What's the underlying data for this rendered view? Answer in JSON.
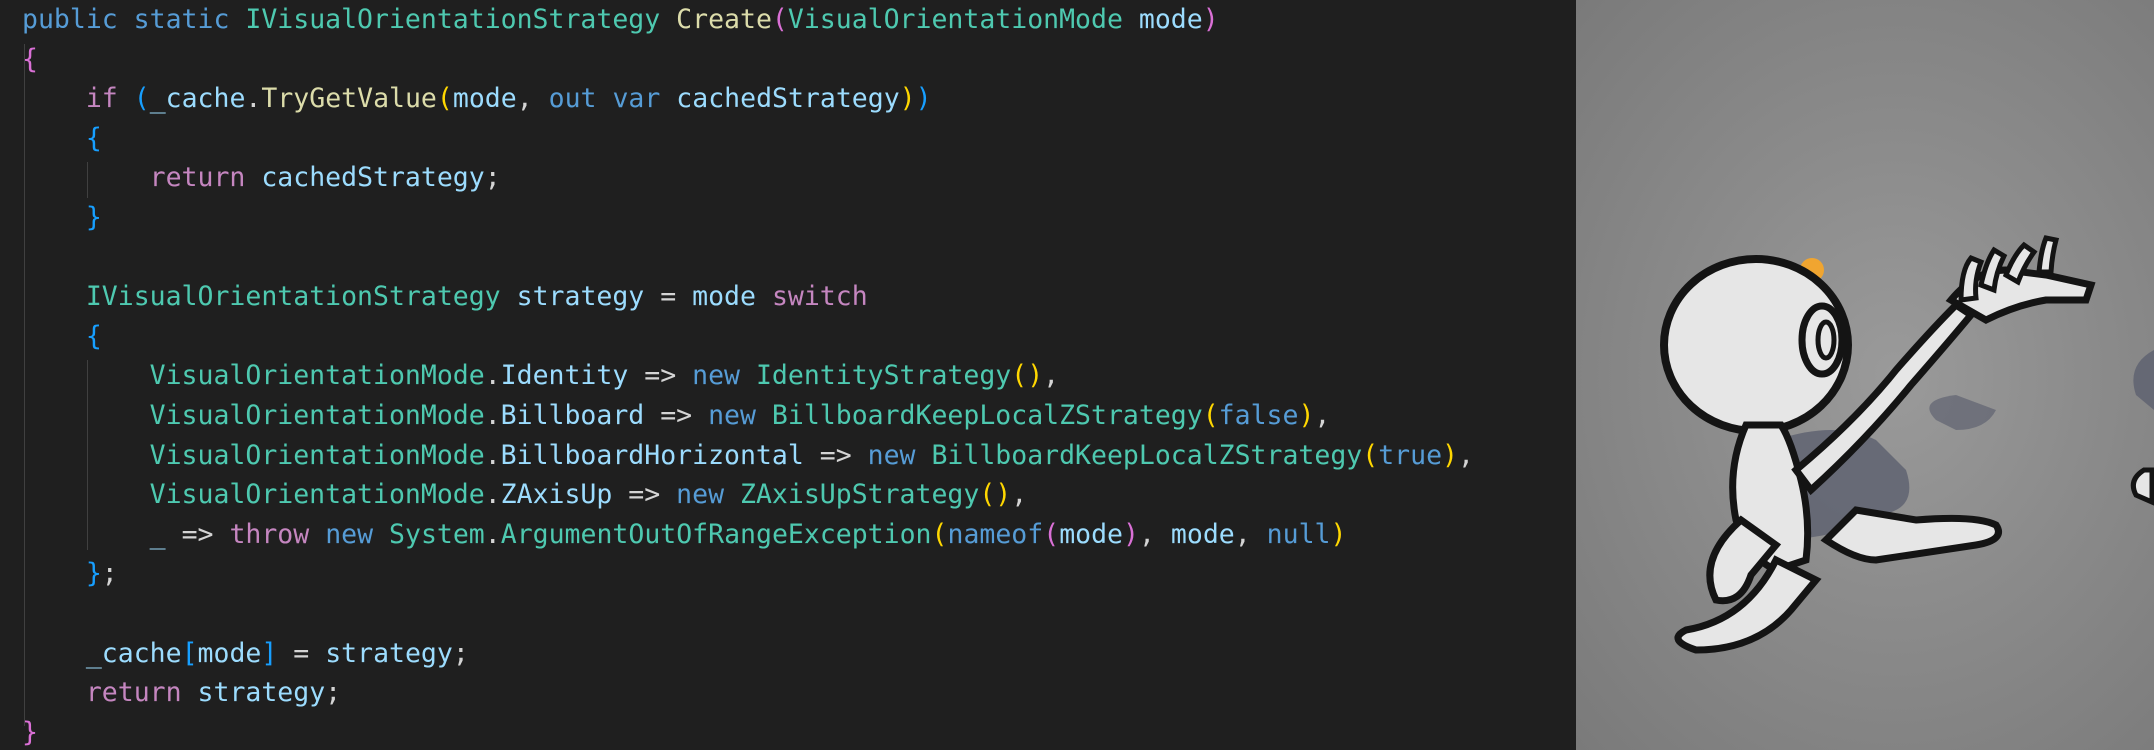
{
  "editor": {
    "theme": {
      "background": "#1f1f1f",
      "default": "#d4d4d4",
      "keyword": "#569cd6",
      "control": "#c586c0",
      "type": "#4ec9b0",
      "method": "#dcdcaa",
      "variable": "#9cdcfe",
      "bracket1": "#ffd700",
      "bracket2": "#da70d6",
      "bracket3": "#179fff"
    },
    "lines": [
      [
        [
          "public static ",
          "keyword"
        ],
        [
          "IVisualOrientationStrategy",
          "type"
        ],
        [
          " ",
          "default"
        ],
        [
          "Create",
          "method"
        ],
        [
          "(",
          "bracket2"
        ],
        [
          "VisualOrientationMode",
          "type"
        ],
        [
          " ",
          "default"
        ],
        [
          "mode",
          "variable"
        ],
        [
          ")",
          "bracket2"
        ]
      ],
      [
        [
          "{",
          "bracket2"
        ]
      ],
      [
        [
          "    ",
          "default"
        ],
        [
          "if",
          "control"
        ],
        [
          " ",
          "default"
        ],
        [
          "(",
          "bracket3"
        ],
        [
          "_cache",
          "variable"
        ],
        [
          ".",
          "default"
        ],
        [
          "TryGetValue",
          "method"
        ],
        [
          "(",
          "bracket1"
        ],
        [
          "mode",
          "variable"
        ],
        [
          ", ",
          "default"
        ],
        [
          "out",
          "keyword"
        ],
        [
          " ",
          "default"
        ],
        [
          "var",
          "keyword"
        ],
        [
          " ",
          "default"
        ],
        [
          "cachedStrategy",
          "variable"
        ],
        [
          ")",
          "bracket1"
        ],
        [
          ")",
          "bracket3"
        ]
      ],
      [
        [
          "    ",
          "default"
        ],
        [
          "{",
          "bracket3"
        ]
      ],
      [
        [
          "        ",
          "default"
        ],
        [
          "return",
          "control"
        ],
        [
          " ",
          "default"
        ],
        [
          "cachedStrategy",
          "variable"
        ],
        [
          ";",
          "default"
        ]
      ],
      [
        [
          "    ",
          "default"
        ],
        [
          "}",
          "bracket3"
        ]
      ],
      [],
      [
        [
          "    ",
          "default"
        ],
        [
          "IVisualOrientationStrategy",
          "type"
        ],
        [
          " ",
          "default"
        ],
        [
          "strategy",
          "variable"
        ],
        [
          " = ",
          "default"
        ],
        [
          "mode",
          "variable"
        ],
        [
          " ",
          "default"
        ],
        [
          "switch",
          "control"
        ]
      ],
      [
        [
          "    ",
          "default"
        ],
        [
          "{",
          "bracket3"
        ]
      ],
      [
        [
          "        ",
          "default"
        ],
        [
          "VisualOrientationMode",
          "type"
        ],
        [
          ".",
          "default"
        ],
        [
          "Identity",
          "variable"
        ],
        [
          " => ",
          "default"
        ],
        [
          "new",
          "keyword"
        ],
        [
          " ",
          "default"
        ],
        [
          "IdentityStrategy",
          "type"
        ],
        [
          "()",
          "bracket1"
        ],
        [
          ",",
          "default"
        ]
      ],
      [
        [
          "        ",
          "default"
        ],
        [
          "VisualOrientationMode",
          "type"
        ],
        [
          ".",
          "default"
        ],
        [
          "Billboard",
          "variable"
        ],
        [
          " => ",
          "default"
        ],
        [
          "new",
          "keyword"
        ],
        [
          " ",
          "default"
        ],
        [
          "BillboardKeepLocalZStrategy",
          "type"
        ],
        [
          "(",
          "bracket1"
        ],
        [
          "false",
          "keyword"
        ],
        [
          ")",
          "bracket1"
        ],
        [
          ",",
          "default"
        ]
      ],
      [
        [
          "        ",
          "default"
        ],
        [
          "VisualOrientationMode",
          "type"
        ],
        [
          ".",
          "default"
        ],
        [
          "BillboardHorizontal",
          "variable"
        ],
        [
          " => ",
          "default"
        ],
        [
          "new",
          "keyword"
        ],
        [
          " ",
          "default"
        ],
        [
          "BillboardKeepLocalZStrategy",
          "type"
        ],
        [
          "(",
          "bracket1"
        ],
        [
          "true",
          "keyword"
        ],
        [
          ")",
          "bracket1"
        ],
        [
          ",",
          "default"
        ]
      ],
      [
        [
          "        ",
          "default"
        ],
        [
          "VisualOrientationMode",
          "type"
        ],
        [
          ".",
          "default"
        ],
        [
          "ZAxisUp",
          "variable"
        ],
        [
          " => ",
          "default"
        ],
        [
          "new",
          "keyword"
        ],
        [
          " ",
          "default"
        ],
        [
          "ZAxisUpStrategy",
          "type"
        ],
        [
          "()",
          "bracket1"
        ],
        [
          ",",
          "default"
        ]
      ],
      [
        [
          "        ",
          "default"
        ],
        [
          "_",
          "variable"
        ],
        [
          " => ",
          "default"
        ],
        [
          "throw",
          "control"
        ],
        [
          " ",
          "default"
        ],
        [
          "new",
          "keyword"
        ],
        [
          " ",
          "default"
        ],
        [
          "System",
          "type"
        ],
        [
          ".",
          "default"
        ],
        [
          "ArgumentOutOfRangeException",
          "type"
        ],
        [
          "(",
          "bracket1"
        ],
        [
          "nameof",
          "keyword"
        ],
        [
          "(",
          "bracket2"
        ],
        [
          "mode",
          "variable"
        ],
        [
          ")",
          "bracket2"
        ],
        [
          ", ",
          "default"
        ],
        [
          "mode",
          "variable"
        ],
        [
          ", ",
          "default"
        ],
        [
          "null",
          "keyword"
        ],
        [
          ")",
          "bracket1"
        ]
      ],
      [
        [
          "    ",
          "default"
        ],
        [
          "}",
          "bracket3"
        ],
        [
          ";",
          "default"
        ]
      ],
      [],
      [
        [
          "    ",
          "default"
        ],
        [
          "_cache",
          "variable"
        ],
        [
          "[",
          "bracket3"
        ],
        [
          "mode",
          "variable"
        ],
        [
          "]",
          "bracket3"
        ],
        [
          " = ",
          "default"
        ],
        [
          "strategy",
          "variable"
        ],
        [
          ";",
          "default"
        ]
      ],
      [
        [
          "    ",
          "default"
        ],
        [
          "return",
          "control"
        ],
        [
          " ",
          "default"
        ],
        [
          "strategy",
          "variable"
        ],
        [
          ";",
          "default"
        ]
      ],
      [
        [
          "}",
          "bracket2"
        ]
      ]
    ]
  },
  "viewport": {
    "background": "#8e8e8e",
    "character_fill": "#e6e6e6",
    "outline": "#141414",
    "shadow": "#5f6371",
    "accent": "#f0a530"
  }
}
